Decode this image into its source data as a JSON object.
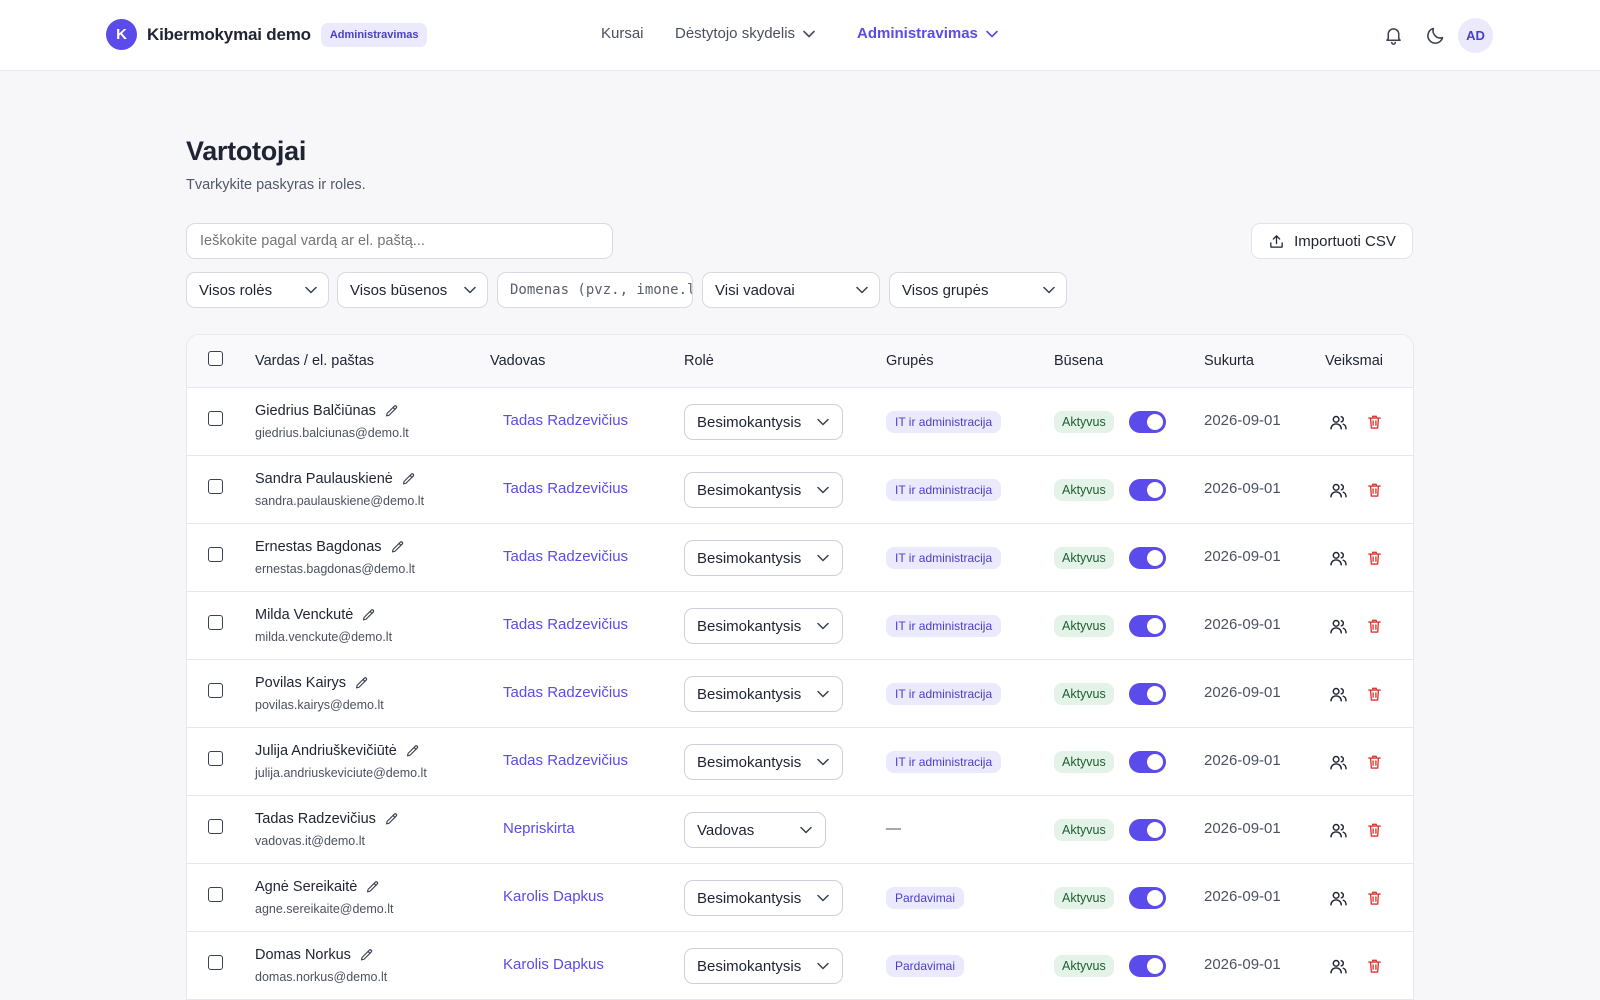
{
  "header": {
    "logo_letter": "K",
    "app_name": "Kibermokymai demo",
    "role_badge": "Administravimas",
    "nav": {
      "kursai": "Kursai",
      "destytojo": "Dėstytojo skydelis",
      "admin": "Administravimas"
    },
    "avatar_initials": "AD",
    "accent_color": "#5b4bea"
  },
  "page": {
    "title": "Vartotojai",
    "subtitle": "Tvarkykite paskyras ir roles."
  },
  "search": {
    "placeholder": "Ieškokite pagal vardą ar el. paštą..."
  },
  "import_label": "Importuoti CSV",
  "filters": {
    "roles": "Visos rolės",
    "statuses": "Visos būsenos",
    "domain_placeholder": "Domenas (pvz., imone.lt)",
    "managers": "Visi vadovai",
    "groups": "Visos grupės"
  },
  "table": {
    "columns": {
      "name": "Vardas / el. paštas",
      "manager": "Vadovas",
      "role": "Rolė",
      "groups": "Grupės",
      "status": "Būsena",
      "created": "Sukurta",
      "actions": "Veiksmai"
    },
    "rows": [
      {
        "name": "Giedrius Balčiūnas",
        "email": "giedrius.balciunas@demo.lt",
        "manager": "Tadas Radzevičius",
        "role": "Besimokantysis",
        "group": "IT ir administracija",
        "status": "Aktyvus",
        "active": true,
        "created": "2026-09-01"
      },
      {
        "name": "Sandra Paulauskienė",
        "email": "sandra.paulauskiene@demo.lt",
        "manager": "Tadas Radzevičius",
        "role": "Besimokantysis",
        "group": "IT ir administracija",
        "status": "Aktyvus",
        "active": true,
        "created": "2026-09-01"
      },
      {
        "name": "Ernestas Bagdonas",
        "email": "ernestas.bagdonas@demo.lt",
        "manager": "Tadas Radzevičius",
        "role": "Besimokantysis",
        "group": "IT ir administracija",
        "status": "Aktyvus",
        "active": true,
        "created": "2026-09-01"
      },
      {
        "name": "Milda Venckutė",
        "email": "milda.venckute@demo.lt",
        "manager": "Tadas Radzevičius",
        "role": "Besimokantysis",
        "group": "IT ir administracija",
        "status": "Aktyvus",
        "active": true,
        "created": "2026-09-01"
      },
      {
        "name": "Povilas Kairys",
        "email": "povilas.kairys@demo.lt",
        "manager": "Tadas Radzevičius",
        "role": "Besimokantysis",
        "group": "IT ir administracija",
        "status": "Aktyvus",
        "active": true,
        "created": "2026-09-01"
      },
      {
        "name": "Julija Andriuškevičiūtė",
        "email": "julija.andriuskeviciute@demo.lt",
        "manager": "Tadas Radzevičius",
        "role": "Besimokantysis",
        "group": "IT ir administracija",
        "status": "Aktyvus",
        "active": true,
        "created": "2026-09-01"
      },
      {
        "name": "Tadas Radzevičius",
        "email": "vadovas.it@demo.lt",
        "manager": "Nepriskirta",
        "role": "Vadovas",
        "group": "—",
        "status": "Aktyvus",
        "active": true,
        "created": "2026-09-01"
      },
      {
        "name": "Agnė Sereikaitė",
        "email": "agne.sereikaite@demo.lt",
        "manager": "Karolis Dapkus",
        "role": "Besimokantysis",
        "group": "Pardavimai",
        "status": "Aktyvus",
        "active": true,
        "created": "2026-09-01"
      },
      {
        "name": "Domas Norkus",
        "email": "domas.norkus@demo.lt",
        "manager": "Karolis Dapkus",
        "role": "Besimokantysis",
        "group": "Pardavimai",
        "status": "Aktyvus",
        "active": true,
        "created": "2026-09-01"
      }
    ]
  }
}
